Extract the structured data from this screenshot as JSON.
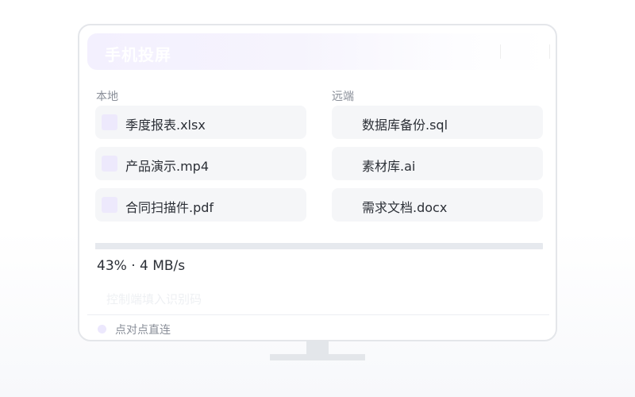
{
  "header": {
    "title": "手机投屏"
  },
  "local": {
    "label": "本地",
    "files": [
      {
        "name": "季度报表.xlsx",
        "icon": "file-icon"
      },
      {
        "name": "产品演示.mp4",
        "icon": "file-icon"
      },
      {
        "name": "合同扫描件.pdf",
        "icon": "file-icon"
      }
    ]
  },
  "remote": {
    "label": "远端",
    "files": [
      {
        "name": "数据库备份.sql"
      },
      {
        "name": "素材库.ai"
      },
      {
        "name": "需求文档.docx"
      }
    ]
  },
  "transfer": {
    "progress": 0.43,
    "status": "43% · 4 MB/s"
  },
  "code": {
    "placeholder": "控制端填入识别码",
    "value": ""
  },
  "footer": {
    "mode": "点对点直连"
  },
  "colors": {
    "accent_light": "#ede9fc",
    "border": "#e4e6ea",
    "card_bg": "#f5f6f8",
    "text": "#2b2f36",
    "muted": "#8a8f99"
  }
}
